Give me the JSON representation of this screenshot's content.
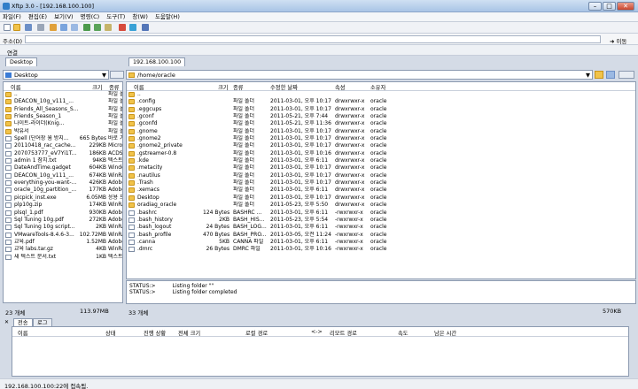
{
  "window": {
    "title": "Xftp 3.0 - [192.168.100.100]",
    "minimize": "–",
    "maximize": "□",
    "close": "✕"
  },
  "menu": [
    "파일(F)",
    "편집(E)",
    "보기(V)",
    "명령(C)",
    "도구(T)",
    "창(W)",
    "도움말(H)"
  ],
  "address": {
    "label": "주소(D)",
    "value": "",
    "go": "이동"
  },
  "links_label": "연결",
  "left": {
    "tab": "Desktop",
    "path": "Desktop",
    "headers": [
      "이름",
      "크기",
      "종류"
    ],
    "items": [
      {
        "name": "..",
        "size": "",
        "type": "파일 폴",
        "kind": "folder"
      },
      {
        "name": "DEACON_10g_v111_...",
        "size": "",
        "type": "파일 폴",
        "kind": "folder"
      },
      {
        "name": "Friends_All_Seasons_S...",
        "size": "",
        "type": "파일 폴",
        "kind": "folder"
      },
      {
        "name": "Friends_Season_1",
        "size": "",
        "type": "파일 폴",
        "kind": "folder"
      },
      {
        "name": "나이트-라이더(Knig...",
        "size": "",
        "type": "파일 폴",
        "kind": "folder"
      },
      {
        "name": "박유서",
        "size": "",
        "type": "파일 폴",
        "kind": "folder"
      },
      {
        "name": "Spell (단어장 웜 방지...",
        "size": "665 Bytes",
        "type": "바로 가",
        "kind": "file"
      },
      {
        "name": "20110418_rac_cache...",
        "size": "229KB",
        "type": "Micros",
        "kind": "file"
      },
      {
        "name": "2070753777_eV7Yi1T...",
        "size": "186KB",
        "type": "ACDSe",
        "kind": "file"
      },
      {
        "name": "admin 1 참치.txt",
        "size": "94KB",
        "type": "텍스트 문",
        "kind": "file"
      },
      {
        "name": "DateAndTime.gadget",
        "size": "604KB",
        "type": "Windo",
        "kind": "file"
      },
      {
        "name": "DEACON_10g_v111_...",
        "size": "674KB",
        "type": "WinRA",
        "kind": "file"
      },
      {
        "name": "everything-you-want-...",
        "size": "426KB",
        "type": "Adobe",
        "kind": "file"
      },
      {
        "name": "oracle_10g_partition_...",
        "size": "177KB",
        "type": "Adobe",
        "kind": "file"
      },
      {
        "name": "picpick_inst.exe",
        "size": "6.05MB",
        "type": "응용 프",
        "kind": "file"
      },
      {
        "name": "plp10g.zip",
        "size": "174KB",
        "type": "WinRA",
        "kind": "file"
      },
      {
        "name": "plsql_1.pdf",
        "size": "930KB",
        "type": "Adobe",
        "kind": "file"
      },
      {
        "name": "Sql Tuning 10g.pdf",
        "size": "272KB",
        "type": "Adobe",
        "kind": "file"
      },
      {
        "name": "Sql Tuning 10g script...",
        "size": "2KB",
        "type": "WinRA",
        "kind": "file"
      },
      {
        "name": "VMwareTools-8.4.6-3...",
        "size": "102.72MB",
        "type": "WinRA",
        "kind": "file"
      },
      {
        "name": "교육.pdf",
        "size": "1.52MB",
        "type": "Adobe",
        "kind": "file"
      },
      {
        "name": "교육 labs.tar.gz",
        "size": "4KB",
        "type": "WinRA",
        "kind": "file"
      },
      {
        "name": "새 텍스트 문서.txt",
        "size": "1KB",
        "type": "텍스트",
        "kind": "file"
      }
    ],
    "status_count": "23 개체",
    "status_size": "113.97MB"
  },
  "right": {
    "tab": "192.168.100.100",
    "path": "/home/oracle",
    "headers": [
      "이름",
      "크기",
      "종류",
      "수정한 날짜",
      "속성",
      "소유자"
    ],
    "items": [
      {
        "name": "..",
        "size": "",
        "type": "",
        "date": "",
        "attr": "",
        "owner": "",
        "kind": "folder"
      },
      {
        "name": ".config",
        "size": "",
        "type": "파일 폴더",
        "date": "2011-03-01, 오후 10:17",
        "attr": "drwxrwxr-x",
        "owner": "oracle",
        "kind": "folder"
      },
      {
        "name": ".eggcups",
        "size": "",
        "type": "파일 폴더",
        "date": "2011-03-01, 오후 10:17",
        "attr": "drwxrwxr-x",
        "owner": "oracle",
        "kind": "folder"
      },
      {
        "name": ".gconf",
        "size": "",
        "type": "파일 폴더",
        "date": "2011-05-21, 오후 7:44",
        "attr": "drwxrwxr-x",
        "owner": "oracle",
        "kind": "folder"
      },
      {
        "name": ".gconfd",
        "size": "",
        "type": "파일 폴더",
        "date": "2011-05-21, 오후 11:36",
        "attr": "drwxrwxr-x",
        "owner": "oracle",
        "kind": "folder"
      },
      {
        "name": ".gnome",
        "size": "",
        "type": "파일 폴더",
        "date": "2011-03-01, 오후 10:17",
        "attr": "drwxrwxr-x",
        "owner": "oracle",
        "kind": "folder"
      },
      {
        "name": ".gnome2",
        "size": "",
        "type": "파일 폴더",
        "date": "2011-03-01, 오후 10:17",
        "attr": "drwxrwxr-x",
        "owner": "oracle",
        "kind": "folder"
      },
      {
        "name": ".gnome2_private",
        "size": "",
        "type": "파일 폴더",
        "date": "2011-03-01, 오후 10:17",
        "attr": "drwxrwxr-x",
        "owner": "oracle",
        "kind": "folder"
      },
      {
        "name": ".gstreamer-0.8",
        "size": "",
        "type": "파일 폴더",
        "date": "2011-03-01, 오후 10:16",
        "attr": "drwxrwxr-x",
        "owner": "oracle",
        "kind": "folder"
      },
      {
        "name": ".kde",
        "size": "",
        "type": "파일 폴더",
        "date": "2011-03-01, 오후 6:11",
        "attr": "drwxrwxr-x",
        "owner": "oracle",
        "kind": "folder"
      },
      {
        "name": ".metacity",
        "size": "",
        "type": "파일 폴더",
        "date": "2011-03-01, 오후 10:17",
        "attr": "drwxrwxr-x",
        "owner": "oracle",
        "kind": "folder"
      },
      {
        "name": ".nautilus",
        "size": "",
        "type": "파일 폴더",
        "date": "2011-03-01, 오후 10:17",
        "attr": "drwxrwxr-x",
        "owner": "oracle",
        "kind": "folder"
      },
      {
        "name": ".Trash",
        "size": "",
        "type": "파일 폴더",
        "date": "2011-03-01, 오후 10:17",
        "attr": "drwxrwxr-x",
        "owner": "oracle",
        "kind": "folder"
      },
      {
        "name": ".xemacs",
        "size": "",
        "type": "파일 폴더",
        "date": "2011-03-01, 오후 6:11",
        "attr": "drwxrwxr-x",
        "owner": "oracle",
        "kind": "folder"
      },
      {
        "name": "Desktop",
        "size": "",
        "type": "파일 폴더",
        "date": "2011-03-01, 오후 10:17",
        "attr": "drwxrwxr-x",
        "owner": "oracle",
        "kind": "folder"
      },
      {
        "name": "oradiag_oracle",
        "size": "",
        "type": "파일 폴더",
        "date": "2011-05-23, 오후 5:50",
        "attr": "drwxrwxr-x",
        "owner": "oracle",
        "kind": "folder"
      },
      {
        "name": ".bashrc",
        "size": "124 Bytes",
        "type": "BASHRC ...",
        "date": "2011-03-01, 오후 6:11",
        "attr": "-rwxrwxr-x",
        "owner": "oracle",
        "kind": "file"
      },
      {
        "name": ".bash_history",
        "size": "2KB",
        "type": "BASH_HIS...",
        "date": "2011-05-23, 오후 5:54",
        "attr": "-rwxrwxr-x",
        "owner": "oracle",
        "kind": "file"
      },
      {
        "name": ".bash_logout",
        "size": "24 Bytes",
        "type": "BASH_LOG...",
        "date": "2011-03-01, 오후 6:11",
        "attr": "-rwxrwxr-x",
        "owner": "oracle",
        "kind": "file"
      },
      {
        "name": ".bash_profile",
        "size": "470 Bytes",
        "type": "BASH_PRO...",
        "date": "2011-03-05, 오전 11:24",
        "attr": "-rwxrwxr-x",
        "owner": "oracle",
        "kind": "file"
      },
      {
        "name": ".canna",
        "size": "5KB",
        "type": "CANNA 파일",
        "date": "2011-03-01, 오후 6:11",
        "attr": "-rwxrwxr-x",
        "owner": "oracle",
        "kind": "file"
      },
      {
        "name": ".dmrc",
        "size": "26 Bytes",
        "type": "DMRC 파일",
        "date": "2011-03-01, 오후 10:16",
        "attr": "-rwxrwxr-x",
        "owner": "oracle",
        "kind": "file"
      }
    ],
    "log": [
      "STATUS:>          Listing folder \"\"",
      "STATUS:>          Listing folder completed"
    ],
    "status_count": "33 개체",
    "status_size": "570KB"
  },
  "transfer": {
    "tabs": [
      "전송",
      "로그"
    ],
    "headers": [
      "이름",
      "상태",
      "진행 상황",
      "전체 크기",
      "로컬 경로",
      "<->",
      "리모트 경로",
      "속도",
      "남은 시간"
    ]
  },
  "statusbar": "192.168.100.100:22에 접속됨."
}
